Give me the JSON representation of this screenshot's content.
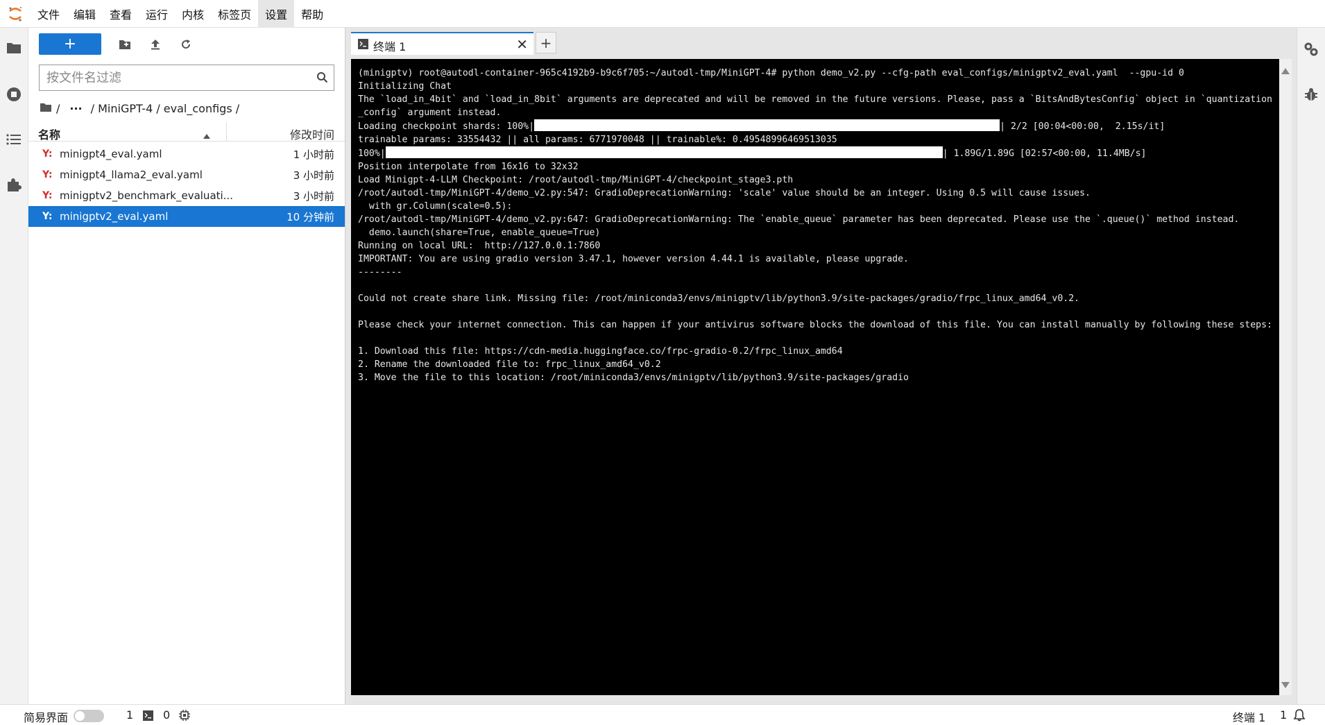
{
  "menubar": {
    "items": [
      "文件",
      "编辑",
      "查看",
      "运行",
      "内核",
      "标签页",
      "设置",
      "帮助"
    ],
    "active_index": 6
  },
  "leftrail": {
    "icons": [
      "folder-icon",
      "running-sessions-icon",
      "table-of-contents-icon",
      "extension-icon"
    ]
  },
  "filebrowser": {
    "new_label": "+",
    "filter_placeholder": "按文件名过滤",
    "breadcrumb": {
      "sep1": "/",
      "ellipsis": "···",
      "path": "/ MiniGPT-4 / eval_configs /"
    },
    "header": {
      "name": "名称",
      "modified": "修改时间"
    },
    "files": [
      {
        "icon": "Y:",
        "name": "minigpt4_eval.yaml",
        "time": "1 小时前",
        "selected": false
      },
      {
        "icon": "Y:",
        "name": "minigpt4_llama2_eval.yaml",
        "time": "3 小时前",
        "selected": false
      },
      {
        "icon": "Y:",
        "name": "minigptv2_benchmark_evaluati...",
        "time": "3 小时前",
        "selected": false
      },
      {
        "icon": "Y:",
        "name": "minigptv2_eval.yaml",
        "time": "10 分钟前",
        "selected": true
      }
    ]
  },
  "tabs": {
    "terminal_label": "终端 1",
    "close": "✕",
    "add": "+"
  },
  "terminal": {
    "l01": "(minigptv) root@autodl-container-965c4192b9-b9c6f705:~/autodl-tmp/MiniGPT-4# python demo_v2.py --cfg-path eval_configs/minigptv2_eval.yaml  --gpu-id 0",
    "l02": "Initializing Chat",
    "l03": "The `load_in_4bit` and `load_in_8bit` arguments are deprecated and will be removed in the future versions. Please, pass a `BitsAndBytesConfig` object in `quantization_config` argument instead.",
    "l04a": "Loading checkpoint shards: 100%|",
    "l04b": "| 2/2 [00:04<00:00,  2.15s/it]",
    "l05": "trainable params: 33554432 || all params: 6771970048 || trainable%: 0.49548996469513035",
    "l06a": "100%|",
    "l06b": "| 1.89G/1.89G [02:57<00:00, 11.4MB/s]",
    "l07": "Position interpolate from 16x16 to 32x32",
    "l08": "Load Minigpt-4-LLM Checkpoint: /root/autodl-tmp/MiniGPT-4/checkpoint_stage3.pth",
    "l09": "/root/autodl-tmp/MiniGPT-4/demo_v2.py:547: GradioDeprecationWarning: 'scale' value should be an integer. Using 0.5 will cause issues.",
    "l10": "  with gr.Column(scale=0.5):",
    "l11": "/root/autodl-tmp/MiniGPT-4/demo_v2.py:647: GradioDeprecationWarning: The `enable_queue` parameter has been deprecated. Please use the `.queue()` method instead.",
    "l12": "  demo.launch(share=True, enable_queue=True)",
    "l13": "Running on local URL:  http://127.0.0.1:7860",
    "l14": "IMPORTANT: You are using gradio version 3.47.1, however version 4.44.1 is available, please upgrade.",
    "l15": "--------",
    "l16": "Could not create share link. Missing file: /root/miniconda3/envs/minigptv/lib/python3.9/site-packages/gradio/frpc_linux_amd64_v0.2.",
    "l17": "Please check your internet connection. This can happen if your antivirus software blocks the download of this file. You can install manually by following these steps:",
    "l18": "1. Download this file: https://cdn-media.huggingface.co/frpc-gradio-0.2/frpc_linux_amd64",
    "l19": "2. Rename the downloaded file to: frpc_linux_amd64_v0.2",
    "l20": "3. Move the file to this location: /root/miniconda3/envs/minigptv/lib/python3.9/site-packages/gradio"
  },
  "statusbar": {
    "simple_mode_label": "简易界面",
    "count1": "1",
    "terminal_count": "0",
    "right_label": "终端 1",
    "right_count": "1"
  },
  "colors": {
    "accent": "#1976d2",
    "terminal_bg": "#000000",
    "yaml_icon": "#d32f2f"
  }
}
